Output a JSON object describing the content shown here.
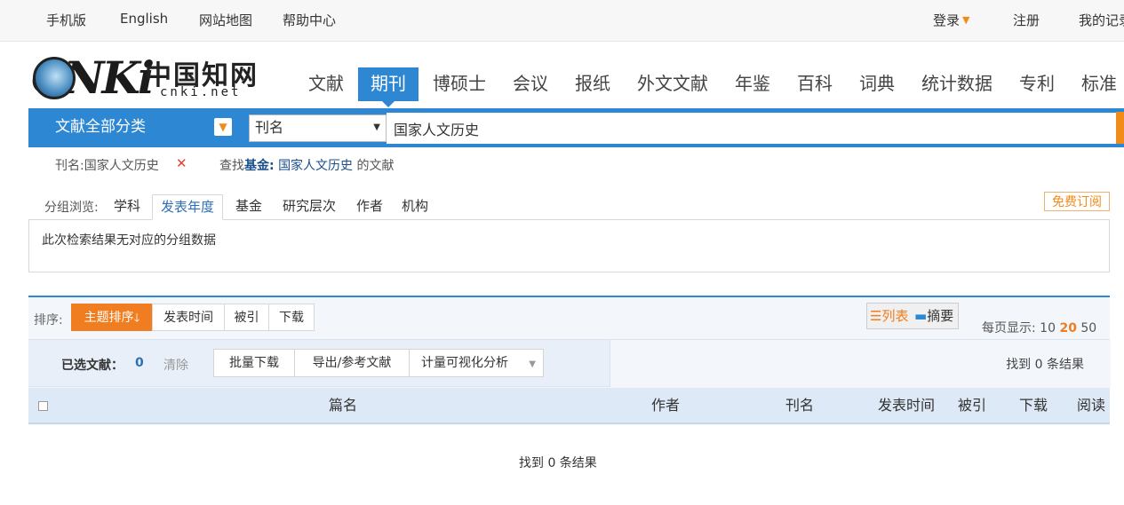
{
  "topbar": {
    "links": [
      "手机版",
      "English",
      "网站地图",
      "帮助中心"
    ],
    "login": "登录",
    "register": "注册",
    "my_records": "我的记录"
  },
  "logo": {
    "brand": "CNKi",
    "chinese": "中国知网",
    "domain": "cnki.net"
  },
  "nav": {
    "items": [
      "文献",
      "期刊",
      "博硕士",
      "会议",
      "报纸",
      "外文文献",
      "年鉴",
      "百科",
      "词典",
      "统计数据",
      "专利",
      "标准"
    ],
    "active": "期刊"
  },
  "search": {
    "category_label": "文献全部分类",
    "field": "刊名",
    "value": "国家人文历史"
  },
  "query": {
    "condition": "刊名:国家人文历史",
    "remove": "✕",
    "find_prefix": "查找",
    "find_field": "基金:",
    "find_value": "国家人文历史",
    "find_suffix": "的文献"
  },
  "group": {
    "label": "分组浏览:",
    "tabs": [
      "学科",
      "发表年度",
      "基金",
      "研究层次",
      "作者",
      "机构"
    ],
    "active": "发表年度",
    "free_subscribe": "免费订阅",
    "empty_message": "此次检索结果无对应的分组数据"
  },
  "sort": {
    "label": "排序:",
    "options": [
      "主题排序",
      "发表时间",
      "被引",
      "下载"
    ],
    "active": "主题排序"
  },
  "view": {
    "list": "列表",
    "abstract": "摘要"
  },
  "per_page": {
    "label": "每页显示:",
    "options": [
      "10",
      "20",
      "50"
    ],
    "selected": "20"
  },
  "toolbar": {
    "selected_label": "已选文献：",
    "selected_count": "0",
    "clear": "清除",
    "batch_download": "批量下载",
    "export": "导出/参考文献",
    "analysis": "计量可视化分析",
    "result_count": "找到 0 条结果"
  },
  "table": {
    "columns": [
      "篇名",
      "作者",
      "刊名",
      "发表时间",
      "被引",
      "下载",
      "阅读"
    ]
  },
  "footer": {
    "result_count": "找到 0 条结果"
  },
  "colors": {
    "accent_blue": "#2d87d3",
    "accent_orange": "#f07d1f",
    "highlight": "#f08c1a"
  }
}
